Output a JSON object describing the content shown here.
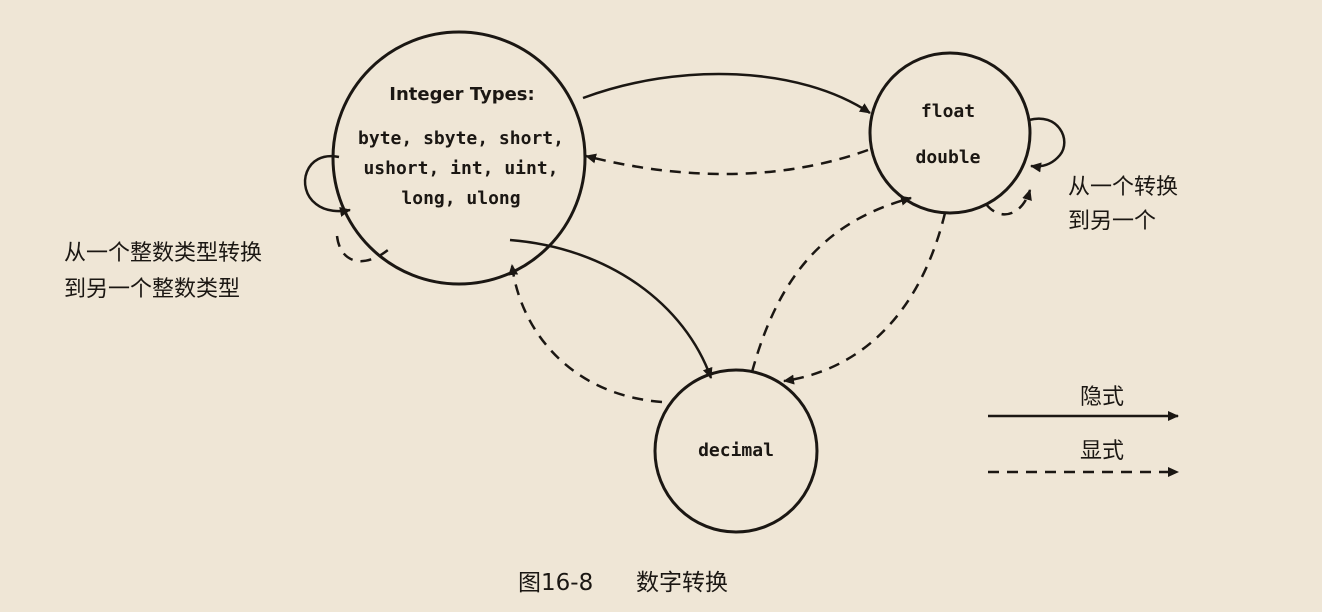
{
  "nodes": {
    "integer": {
      "heading": "Integer Types:",
      "lines": [
        "byte, sbyte, short,",
        "ushort, int, uint,",
        "long, ulong"
      ]
    },
    "float": {
      "lines": [
        "float",
        "double"
      ]
    },
    "decimal": {
      "lines": [
        "decimal"
      ]
    }
  },
  "notes": {
    "integer_self": [
      "从一个整数类型转换",
      "到另一个整数类型"
    ],
    "float_self": [
      "从一个转换",
      "到另一个"
    ]
  },
  "legend": {
    "implicit": "隐式",
    "explicit": "显式"
  },
  "caption": {
    "number": "图16-8",
    "title": "数字转换"
  },
  "colors": {
    "background": "#efe6d6",
    "ink": "#1b1713"
  }
}
